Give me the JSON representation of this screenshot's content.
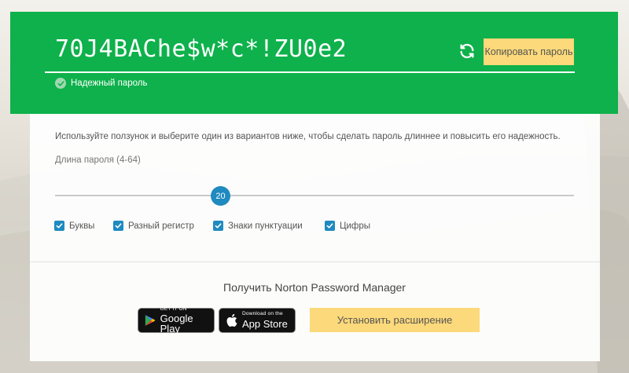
{
  "generator": {
    "password": "70J4BAChe$w*c*!ZU0e2",
    "copy_label": "Копировать пароль",
    "strength_label": "Надежный пароль",
    "refresh_icon": "refresh-icon",
    "accent_color": "#0eb14b"
  },
  "settings": {
    "hint": "Используйте ползунок и выберите один из вариантов ниже, чтобы сделать пароль длиннее и повысить его надежность.",
    "length_label": "Длина пароля (4-64)",
    "length_value": "20",
    "length_min": 4,
    "length_max": 64,
    "options": [
      {
        "label": "Буквы",
        "checked": true
      },
      {
        "label": "Разный регистр",
        "checked": true
      },
      {
        "label": "Знаки пунктуации",
        "checked": true
      },
      {
        "label": "Цифры",
        "checked": true
      }
    ]
  },
  "promo": {
    "title": "Получить Norton Password Manager",
    "google_play": {
      "small": "GET IT ON",
      "big": "Google Play"
    },
    "app_store": {
      "small": "Download on the",
      "big": "App Store"
    },
    "install_label": "Установить расширение"
  }
}
